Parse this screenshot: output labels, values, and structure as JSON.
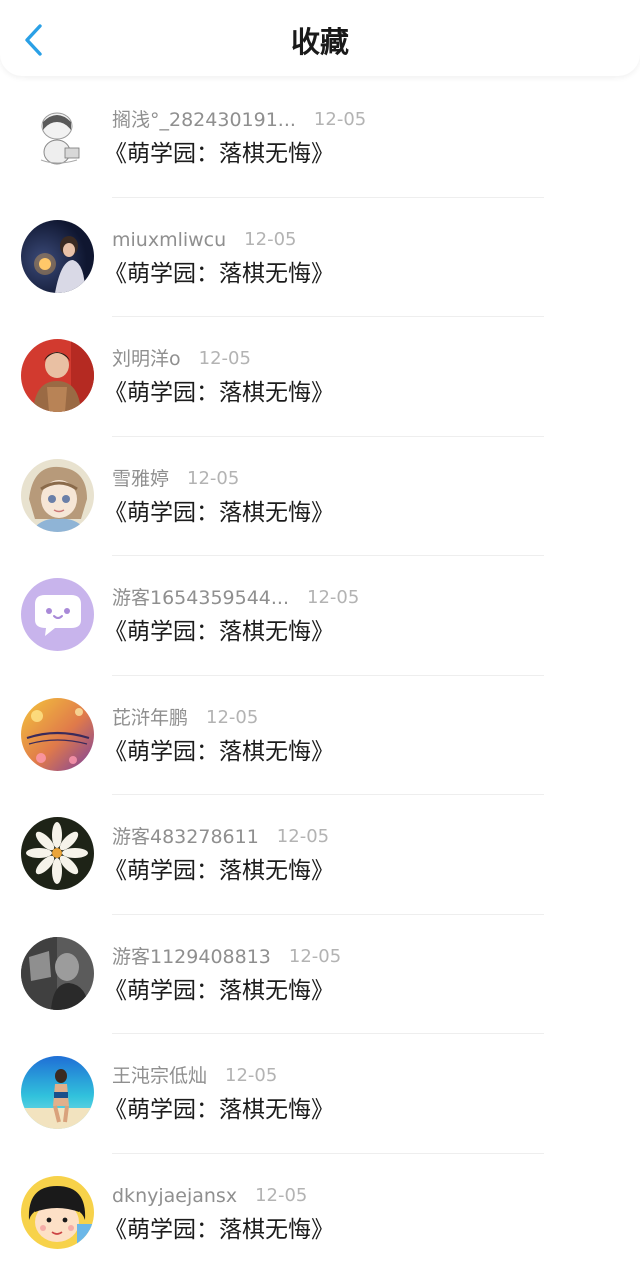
{
  "header": {
    "title": "收藏",
    "back_icon": "chevron-left-icon",
    "accent_color": "#2aa0e6"
  },
  "favorites": [
    {
      "user": "搁浅°_282430191...",
      "date": "12-05",
      "title": "《萌学园：落棋无悔》"
    },
    {
      "user": "miuxmliwcu",
      "date": "12-05",
      "title": "《萌学园：落棋无悔》"
    },
    {
      "user": "刘明洋o",
      "date": "12-05",
      "title": "《萌学园：落棋无悔》"
    },
    {
      "user": "雪雅婷",
      "date": "12-05",
      "title": "《萌学园：落棋无悔》"
    },
    {
      "user": "游客1654359544...",
      "date": "12-05",
      "title": "《萌学园：落棋无悔》"
    },
    {
      "user": "芘浒年鹏",
      "date": "12-05",
      "title": "《萌学园：落棋无悔》"
    },
    {
      "user": "游客483278611",
      "date": "12-05",
      "title": "《萌学园：落棋无悔》"
    },
    {
      "user": "游客1129408813",
      "date": "12-05",
      "title": "《萌学园：落棋无悔》"
    },
    {
      "user": "王沌宗低灿",
      "date": "12-05",
      "title": "《萌学园：落棋无悔》"
    },
    {
      "user": "dknyjaejansx",
      "date": "12-05",
      "title": "《萌学园：落棋无悔》"
    }
  ]
}
